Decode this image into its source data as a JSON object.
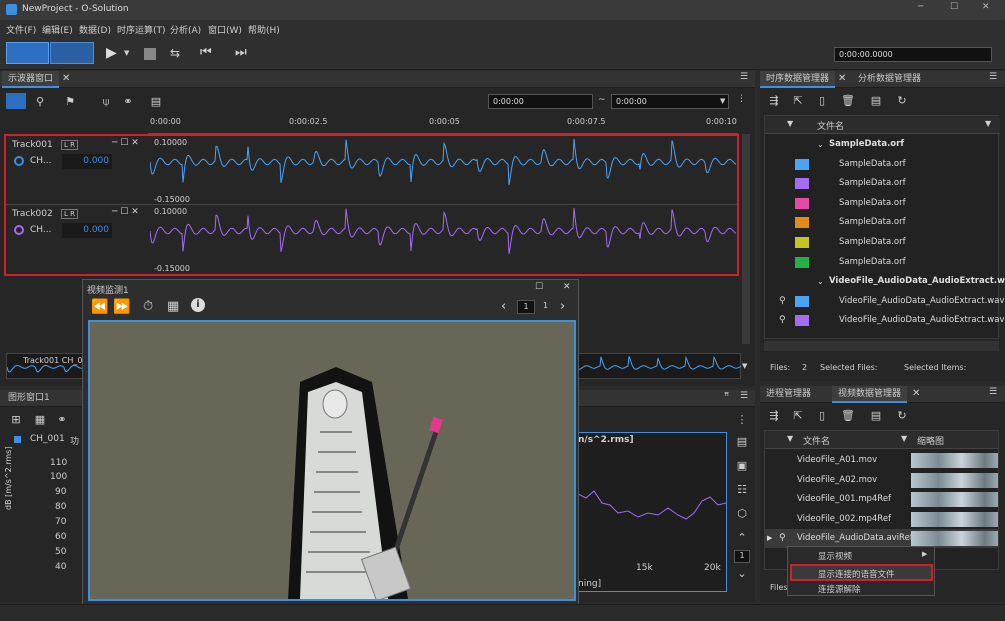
{
  "app": {
    "title": "NewProject - O-Solution"
  },
  "menu": [
    "文件(F)",
    "编辑(E)",
    "数据(D)",
    "时序运算(T)",
    "分析(A)",
    "窗口(W)",
    "帮助(H)"
  ],
  "toolbar": {
    "time_value": "0:00:00.0000"
  },
  "scope": {
    "tab": "示波器窗口",
    "range_start": "0:00:00",
    "range_sep": "~",
    "range_end": "0:00:00",
    "ticks": [
      "0:00:00",
      "0:00:02.5",
      "0:00:05",
      "0:00:07.5",
      "0:00:10"
    ],
    "tracks": [
      {
        "name": "Track001",
        "flags": "L R",
        "channel": "CH...",
        "value": "0.000",
        "ymax": "0.10000",
        "ymin": "-0.15000",
        "color": "#4aa3f5"
      },
      {
        "name": "Track002",
        "flags": "L R",
        "channel": "CH...",
        "value": "0.000",
        "ymax": "0.10000",
        "ymin": "-0.15000",
        "color": "#a36cf2"
      }
    ],
    "overview_label": "Track001  CH_0"
  },
  "graph": {
    "tab": "图形窗口1",
    "channel": "CH_001",
    "col2": "功",
    "unit_title": "n/s^2.rms]",
    "ylabel": "dB [m/s^2.rms]",
    "yticks": [
      "110",
      "100",
      "90",
      "80",
      "70",
      "60",
      "50",
      "40"
    ],
    "xticks": [
      "15k",
      "20k"
    ],
    "xlabel": "ning]",
    "page_num": "1"
  },
  "video": {
    "title": "视频监测1",
    "page_current": "1",
    "page_total": "1"
  },
  "seq": {
    "tabs": [
      "时序数据管理器",
      "分析数据管理器"
    ],
    "header": "文件名",
    "rows": [
      {
        "label": "SampleData.orf",
        "group": true
      },
      {
        "label": "SampleData.orf",
        "color": "#4aa3f5"
      },
      {
        "label": "SampleData.orf",
        "color": "#a36cf2"
      },
      {
        "label": "SampleData.orf",
        "color": "#e64aa8"
      },
      {
        "label": "SampleData.orf",
        "color": "#e38a1c"
      },
      {
        "label": "SampleData.orf",
        "color": "#c4c424"
      },
      {
        "label": "SampleData.orf",
        "color": "#22b24a"
      },
      {
        "label": "VideoFile_AudioData_AudioExtract.wav",
        "group": true
      },
      {
        "label": "VideoFile_AudioData_AudioExtract.wav",
        "color": "#4aa3f5"
      },
      {
        "label": "VideoFile_AudioData_AudioExtract.wav",
        "color": "#a36cf2"
      }
    ],
    "status": {
      "files_label": "Files:",
      "files_count": "2",
      "selected_files": "Selected Files:",
      "selected_items": "Selected Items:"
    }
  },
  "video_mgr": {
    "tabs": [
      "进程管理器",
      "视频数据管理器"
    ],
    "header_name": "文件名",
    "header_thumb": "缩略图",
    "rows": [
      "VideoFile_A01.mov",
      "VideoFile_A02.mov",
      "VideoFile_001.mp4Ref",
      "VideoFile_002.mp4Ref",
      "VideoFile_AudioData.aviRef"
    ],
    "status_files": "Files:"
  },
  "context_menu": {
    "items": [
      "显示视频",
      "显示连接的语音文件",
      "连接源解除"
    ]
  }
}
